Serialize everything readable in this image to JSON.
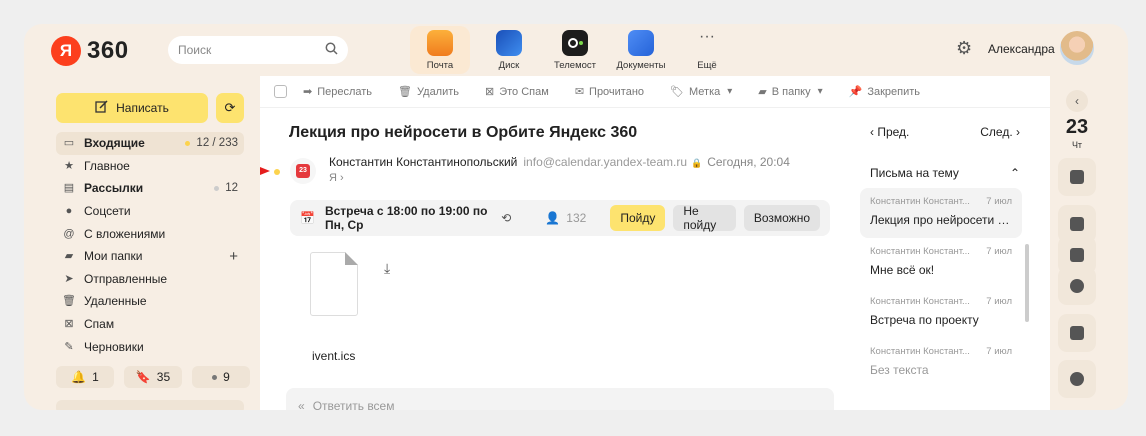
{
  "header": {
    "logo_text": "360",
    "logo_letter": "Я",
    "search_placeholder": "Поиск",
    "apps": [
      {
        "label": "Почта",
        "icon": "mail-icon",
        "color": "#f5a524"
      },
      {
        "label": "Диск",
        "icon": "disk-icon",
        "color": "#2a6ed6"
      },
      {
        "label": "Телемост",
        "icon": "telemost-icon",
        "color": "#222222"
      },
      {
        "label": "Документы",
        "icon": "documents-icon",
        "color": "#3b7bf0"
      },
      {
        "label": "Ещё",
        "icon": "more-icon",
        "color": ""
      }
    ],
    "user_name": "Александра"
  },
  "sidebar": {
    "compose_label": "Написать",
    "folders": [
      {
        "label": "Входящие",
        "count": "12 / 233",
        "bold": true
      },
      {
        "label": "Главное",
        "count": ""
      },
      {
        "label": "Рассылки",
        "count": "12",
        "bold": true
      },
      {
        "label": "Соцсети",
        "count": ""
      },
      {
        "label": "С вложениями",
        "count": ""
      },
      {
        "label": "Мои папки",
        "count": "+"
      },
      {
        "label": "Отправленные",
        "count": ""
      },
      {
        "label": "Удаленные",
        "count": ""
      },
      {
        "label": "Спам",
        "count": ""
      },
      {
        "label": "Черновики",
        "count": ""
      }
    ],
    "counters": [
      "1",
      "35",
      "9"
    ]
  },
  "toolbar": {
    "forward": "Переслать",
    "delete": "Удалить",
    "spam": "Это Спам",
    "read": "Прочитано",
    "label": "Метка",
    "move": "В папку",
    "pin": "Закрепить"
  },
  "message": {
    "subject": "Лекция про нейросети в Орбите Яндекс 360",
    "sender_name": "Константин Константинопольский",
    "sender_email": "info@calendar.yandex-team.ru",
    "date": "Сегодня, 20:04",
    "to": "Я ›",
    "calendar_day": "23",
    "meeting_text": "Встреча с 18:00 по 19:00 по Пн, Ср",
    "attendees": "132",
    "btn_go": "Пойду",
    "btn_no": "Не пойду",
    "btn_maybe": "Возможно",
    "attachment_name": "ivent.ics",
    "reply_placeholder": "Ответить всем"
  },
  "thread": {
    "prev": "Пред.",
    "next": "След.",
    "title": "Письма на тему",
    "items": [
      {
        "from": "Константин Констант...",
        "date": "7 июл",
        "subject": "Лекция про нейросети в Орбите"
      },
      {
        "from": "Константин Констант...",
        "date": "7 июл",
        "subject": "Мне всё ок!"
      },
      {
        "from": "Константин Констант...",
        "date": "7 июл",
        "subject": "Встреча по проекту"
      },
      {
        "from": "Константин Констант...",
        "date": "7 июл",
        "subject": "Без текста"
      }
    ]
  },
  "rail": {
    "day": "23",
    "weekday": "Чт"
  }
}
